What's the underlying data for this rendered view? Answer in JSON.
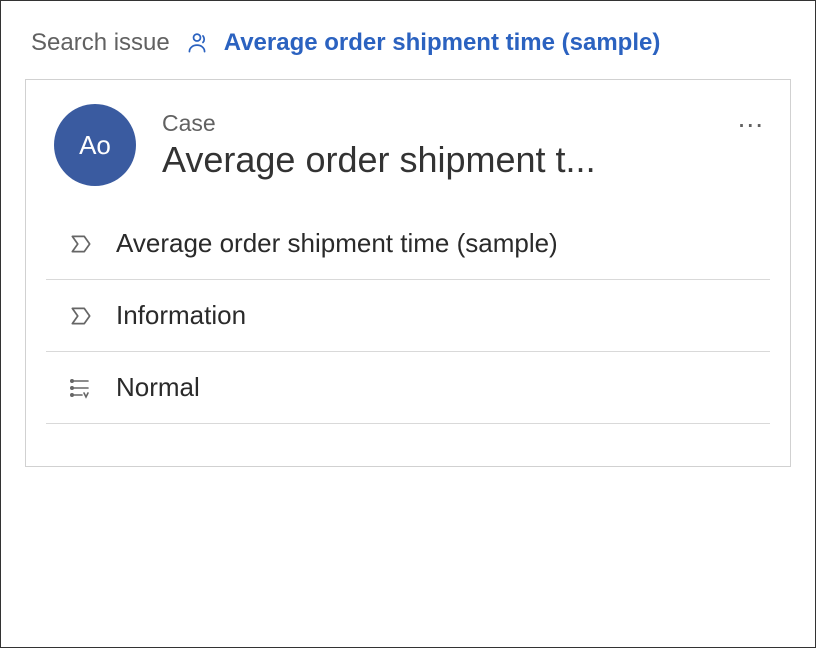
{
  "breadcrumb": {
    "root": "Search issue",
    "current": "Average order shipment time (sample)"
  },
  "card": {
    "avatar_initials": "Ao",
    "entity_type": "Case",
    "title_truncated": "Average order shipment t...",
    "more_label": "..."
  },
  "details": [
    {
      "value": "Average order shipment time (sample)"
    },
    {
      "value": "Information"
    },
    {
      "value": "Normal"
    }
  ],
  "colors": {
    "link": "#2b62c0",
    "avatar_bg": "#3a5ba0",
    "muted": "#616161"
  }
}
